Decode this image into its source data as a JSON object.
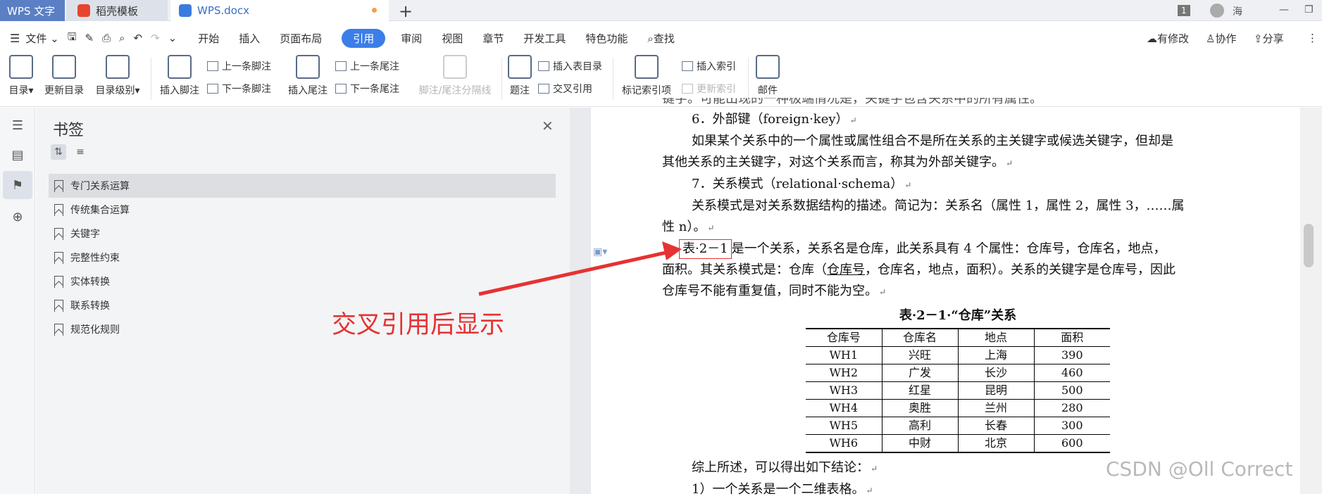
{
  "titlebar": {
    "tabs": [
      {
        "label": "WPS 文字"
      },
      {
        "label": "稻壳模板"
      },
      {
        "label": "WPS.docx"
      }
    ],
    "new_tab": "+",
    "window_count": "1",
    "user": "海"
  },
  "menubar": {
    "file_label": "文件",
    "items": [
      "开始",
      "插入",
      "页面布局",
      "引用",
      "审阅",
      "视图",
      "章节",
      "开发工具",
      "特色功能"
    ],
    "active": "引用",
    "search_label": "查找",
    "right": [
      "有修改",
      "协作",
      "分享"
    ]
  },
  "ribbon": {
    "toc": "目录",
    "update_toc": "更新目录",
    "toc_level": "目录级别",
    "insert_footnote": "插入脚注",
    "prev_footnote": "上一条脚注",
    "next_footnote": "下一条脚注",
    "insert_endnote": "插入尾注",
    "prev_endnote": "上一条尾注",
    "next_endnote": "下一条尾注",
    "separator": "脚注/尾注分隔线",
    "caption": "题注",
    "insert_table_toc": "插入表目录",
    "cross_ref": "交叉引用",
    "mark_index": "标记索引项",
    "insert_index": "插入索引",
    "update_index": "更新索引",
    "mail": "邮件"
  },
  "bookmarks": {
    "title": "书签",
    "items": [
      "专门关系运算",
      "传统集合运算",
      "关键字",
      "完整性约束",
      "实体转换",
      "联系转换",
      "规范化规则"
    ]
  },
  "annotation": "交叉引用后显示",
  "doc": {
    "line0": "键字。可能出现的一种极端情况是，关键字包含关系中的所有属性。",
    "h6": "6．外部键（foreign·key）",
    "p6a": "如果某个关系中的一个属性或属性组合不是所在关系的主关键字或候选关键字，但却是",
    "p6b": "其他关系的主关键字，对这个关系而言，称其为外部关键字。",
    "h7": "7．关系模式（relational·schema）",
    "p7a": "关系模式是对关系数据结构的描述。简记为：关系名（属性 1，属性 2，属性 3，……属",
    "p7b": "性 n）。",
    "xref": "表·2－1",
    "p8a": "是一个关系，关系名是仓库，此关系具有 4 个属性：仓库号，仓库名，地点，",
    "p8b_pre": "面积。其关系模式是：仓库（",
    "p8b_key": "仓库号",
    "p8b_post": "，仓库名，地点，面积）。关系的关键字是仓库号，因此",
    "p8c": "仓库号不能有重复值，同时不能为空。",
    "caption": "表·2－1·“仓库”关系",
    "table": {
      "headers": [
        "仓库号",
        "仓库名",
        "地点",
        "面积"
      ],
      "rows": [
        [
          "WH1",
          "兴旺",
          "上海",
          "390"
        ],
        [
          "WH2",
          "广发",
          "长沙",
          "460"
        ],
        [
          "WH3",
          "红星",
          "昆明",
          "500"
        ],
        [
          "WH4",
          "奥胜",
          "兰州",
          "280"
        ],
        [
          "WH5",
          "高利",
          "长春",
          "300"
        ],
        [
          "WH6",
          "中财",
          "北京",
          "600"
        ]
      ]
    },
    "conclusion": "综上所述，可以得出如下结论：",
    "c1": "1）一个关系是一个二维表格。"
  },
  "watermark": "CSDN @Oll Correct",
  "colors": {
    "accent": "#3c7ee8",
    "annotation": "#e63232",
    "wps_tab": "#5b7fc4"
  }
}
